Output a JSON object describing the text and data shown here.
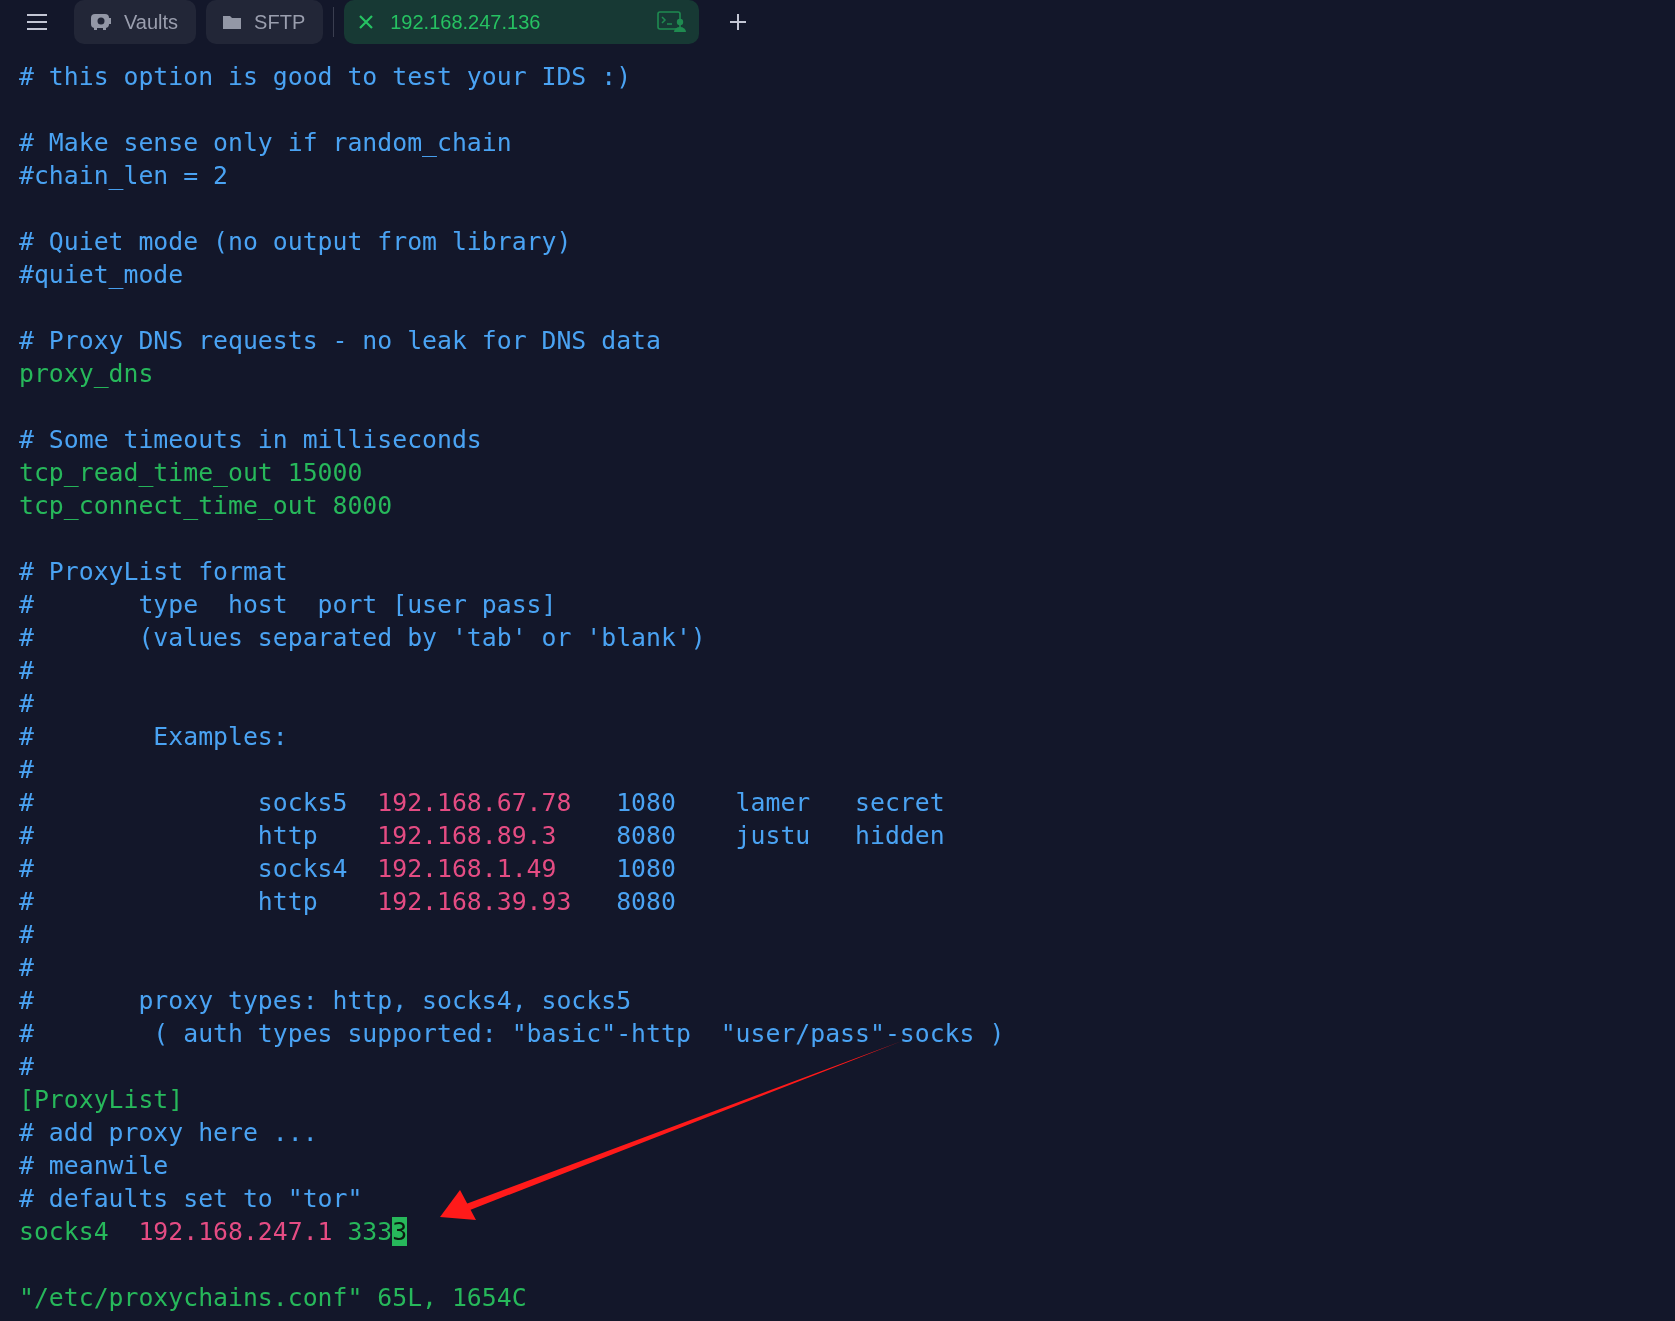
{
  "tabs": [
    {
      "label": "Vaults",
      "kind": "vault",
      "selected": false
    },
    {
      "label": "SFTP",
      "kind": "folder",
      "selected": false
    },
    {
      "label": "192.168.247.136",
      "kind": "host",
      "selected": true
    }
  ],
  "lines": [
    {
      "kind": "code",
      "segments": [
        {
          "text": "# this option is good to test your IDS :)",
          "kind": "comment"
        }
      ]
    },
    {
      "kind": "blank"
    },
    {
      "kind": "code",
      "segments": [
        {
          "text": "# Make sense only if random_chain",
          "kind": "comment"
        }
      ]
    },
    {
      "kind": "code",
      "segments": [
        {
          "text": "#chain_len = 2",
          "kind": "comment"
        }
      ]
    },
    {
      "kind": "blank"
    },
    {
      "kind": "code",
      "segments": [
        {
          "text": "# Quiet mode (no output from library)",
          "kind": "comment"
        }
      ]
    },
    {
      "kind": "code",
      "segments": [
        {
          "text": "#quiet_mode",
          "kind": "comment"
        }
      ]
    },
    {
      "kind": "blank"
    },
    {
      "kind": "code",
      "segments": [
        {
          "text": "# Proxy DNS requests - no leak for DNS data",
          "kind": "comment"
        }
      ]
    },
    {
      "kind": "code",
      "segments": [
        {
          "text": "proxy_dns",
          "kind": "setting"
        }
      ]
    },
    {
      "kind": "blank"
    },
    {
      "kind": "code",
      "segments": [
        {
          "text": "# Some timeouts in milliseconds",
          "kind": "comment"
        }
      ]
    },
    {
      "kind": "code",
      "segments": [
        {
          "text": "tcp_read_time_out 15000",
          "kind": "setting"
        }
      ]
    },
    {
      "kind": "code",
      "segments": [
        {
          "text": "tcp_connect_time_out 8000",
          "kind": "setting"
        }
      ]
    },
    {
      "kind": "blank"
    },
    {
      "kind": "code",
      "segments": [
        {
          "text": "# ProxyList format",
          "kind": "comment"
        }
      ]
    },
    {
      "kind": "code",
      "segments": [
        {
          "text": "#       type  host  port [user pass]",
          "kind": "comment"
        }
      ]
    },
    {
      "kind": "code",
      "segments": [
        {
          "text": "#       (values separated by 'tab' or 'blank')",
          "kind": "comment"
        }
      ]
    },
    {
      "kind": "code",
      "segments": [
        {
          "text": "#",
          "kind": "comment"
        }
      ]
    },
    {
      "kind": "code",
      "segments": [
        {
          "text": "#",
          "kind": "comment"
        }
      ]
    },
    {
      "kind": "code",
      "segments": [
        {
          "text": "#        Examples:",
          "kind": "comment"
        }
      ]
    },
    {
      "kind": "code",
      "segments": [
        {
          "text": "#",
          "kind": "comment"
        }
      ]
    },
    {
      "kind": "code",
      "segments": [
        {
          "text": "#               socks5  ",
          "kind": "comment"
        },
        {
          "text": "192.168.67.78",
          "kind": "ip"
        },
        {
          "text": "   1080    lamer   secret",
          "kind": "comment"
        }
      ]
    },
    {
      "kind": "code",
      "segments": [
        {
          "text": "#               http    ",
          "kind": "comment"
        },
        {
          "text": "192.168.89.3",
          "kind": "ip"
        },
        {
          "text": "    8080    justu   hidden",
          "kind": "comment"
        }
      ]
    },
    {
      "kind": "code",
      "segments": [
        {
          "text": "#               socks4  ",
          "kind": "comment"
        },
        {
          "text": "192.168.1.49",
          "kind": "ip"
        },
        {
          "text": "    1080",
          "kind": "comment"
        }
      ]
    },
    {
      "kind": "code",
      "segments": [
        {
          "text": "#               http    ",
          "kind": "comment"
        },
        {
          "text": "192.168.39.93",
          "kind": "ip"
        },
        {
          "text": "   8080",
          "kind": "comment"
        }
      ]
    },
    {
      "kind": "code",
      "segments": [
        {
          "text": "#",
          "kind": "comment"
        }
      ]
    },
    {
      "kind": "code",
      "segments": [
        {
          "text": "#",
          "kind": "comment"
        }
      ]
    },
    {
      "kind": "code",
      "segments": [
        {
          "text": "#       proxy types: http, socks4, socks5",
          "kind": "comment"
        }
      ]
    },
    {
      "kind": "code",
      "segments": [
        {
          "text": "#        ( auth types supported: \"basic\"-http  \"user/pass\"-socks )",
          "kind": "comment"
        }
      ]
    },
    {
      "kind": "code",
      "segments": [
        {
          "text": "#",
          "kind": "comment"
        }
      ]
    },
    {
      "kind": "code",
      "segments": [
        {
          "text": "[ProxyList]",
          "kind": "setting"
        }
      ]
    },
    {
      "kind": "code",
      "segments": [
        {
          "text": "# add proxy here ...",
          "kind": "comment"
        }
      ]
    },
    {
      "kind": "code",
      "segments": [
        {
          "text": "# meanwile",
          "kind": "comment"
        }
      ]
    },
    {
      "kind": "code",
      "segments": [
        {
          "text": "# defaults set to \"tor\"",
          "kind": "comment"
        }
      ]
    },
    {
      "kind": "code",
      "segments": [
        {
          "text": "socks4  ",
          "kind": "setting"
        },
        {
          "text": "192.168.247.1",
          "kind": "ip"
        },
        {
          "text": " 333",
          "kind": "setting"
        },
        {
          "text": "3",
          "kind": "cursor"
        }
      ]
    },
    {
      "kind": "blank"
    },
    {
      "kind": "code",
      "segments": [
        {
          "text": "\"/etc/proxychains.conf\" 65L, 1654C",
          "kind": "setting"
        }
      ]
    }
  ]
}
